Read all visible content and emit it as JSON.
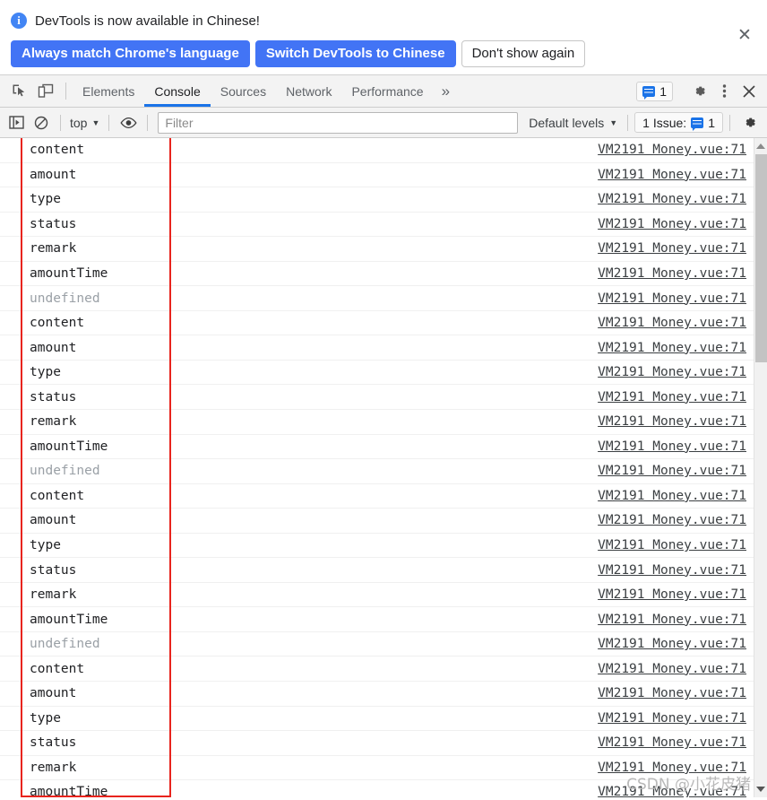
{
  "banner": {
    "icon": "info-icon",
    "message": "DevTools is now available in Chinese!",
    "primary_button": "Always match Chrome's language",
    "secondary_button": "Switch DevTools to Chinese",
    "dismiss_button": "Don't show again",
    "close_icon": "✕",
    "primary_color": "#4274f5",
    "info_color": "#4285f4"
  },
  "tabbar": {
    "inspect_icon": "inspect-element-icon",
    "device_icon": "device-toolbar-icon",
    "tabs": [
      {
        "label": "Elements",
        "active": false
      },
      {
        "label": "Console",
        "active": true
      },
      {
        "label": "Sources",
        "active": false
      },
      {
        "label": "Network",
        "active": false
      },
      {
        "label": "Performance",
        "active": false
      }
    ],
    "more_tabs": "»",
    "issues_count": "1",
    "settings_icon": "gear-icon",
    "menu_icon": "kebab-menu-icon",
    "close_icon": "✕",
    "accent_color": "#1a73e8"
  },
  "console_toolbar": {
    "sidebar_icon": "console-sidebar-icon",
    "clear_icon": "clear-console-icon",
    "context": "top",
    "context_caret": "▼",
    "eye_icon": "live-expression-eye-icon",
    "filter_placeholder": "Filter",
    "filter_value": "",
    "levels_label": "Default levels",
    "levels_caret": "▼",
    "issue_label": "1 Issue:",
    "issue_count": "1",
    "settings_icon": "gear-icon"
  },
  "console": {
    "source_link": "VM2191 Money.vue:71",
    "messages": [
      {
        "text": "content",
        "undefined": false
      },
      {
        "text": "amount",
        "undefined": false
      },
      {
        "text": "type",
        "undefined": false
      },
      {
        "text": "status",
        "undefined": false
      },
      {
        "text": "remark",
        "undefined": false
      },
      {
        "text": "amountTime",
        "undefined": false
      },
      {
        "text": "undefined",
        "undefined": true
      },
      {
        "text": "content",
        "undefined": false
      },
      {
        "text": "amount",
        "undefined": false
      },
      {
        "text": "type",
        "undefined": false
      },
      {
        "text": "status",
        "undefined": false
      },
      {
        "text": "remark",
        "undefined": false
      },
      {
        "text": "amountTime",
        "undefined": false
      },
      {
        "text": "undefined",
        "undefined": true
      },
      {
        "text": "content",
        "undefined": false
      },
      {
        "text": "amount",
        "undefined": false
      },
      {
        "text": "type",
        "undefined": false
      },
      {
        "text": "status",
        "undefined": false
      },
      {
        "text": "remark",
        "undefined": false
      },
      {
        "text": "amountTime",
        "undefined": false
      },
      {
        "text": "undefined",
        "undefined": true
      },
      {
        "text": "content",
        "undefined": false
      },
      {
        "text": "amount",
        "undefined": false
      },
      {
        "text": "type",
        "undefined": false
      },
      {
        "text": "status",
        "undefined": false
      },
      {
        "text": "remark",
        "undefined": false
      },
      {
        "text": "amountTime",
        "undefined": false
      }
    ],
    "annotation_color": "#e8241d"
  },
  "watermark": "CSDN @小花皮猪"
}
